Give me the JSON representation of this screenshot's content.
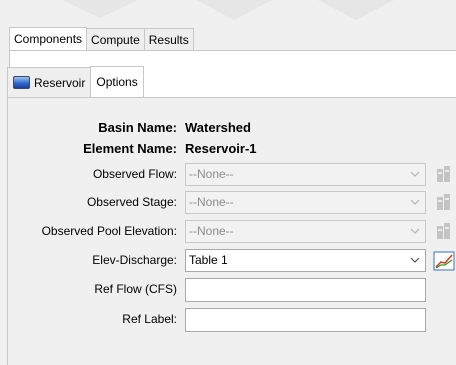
{
  "tabs": [
    "Components",
    "Compute",
    "Results"
  ],
  "subtabs": [
    {
      "label": "Reservoir",
      "icon": "reservoir-icon"
    },
    {
      "label": "Options"
    }
  ],
  "form": {
    "basin_label": "Basin Name:",
    "basin_value": "Watershed",
    "element_label": "Element Name:",
    "element_value": "Reservoir-1",
    "observed_flow_label": "Observed Flow:",
    "observed_flow_value": "--None--",
    "observed_stage_label": "Observed Stage:",
    "observed_stage_value": "--None--",
    "observed_pool_label": "Observed Pool Elevation:",
    "observed_pool_value": "--None--",
    "elev_label": "Elev-Discharge:",
    "elev_value": "Table 1",
    "ref_flow_label": "Ref Flow (CFS)",
    "ref_flow_value": "",
    "ref_label_label": "Ref Label:",
    "ref_label_value": ""
  },
  "colors": {
    "border": "#c8c8c8",
    "disabled_text": "#8c8c8c",
    "panel_bg": "#f0f0f0"
  }
}
